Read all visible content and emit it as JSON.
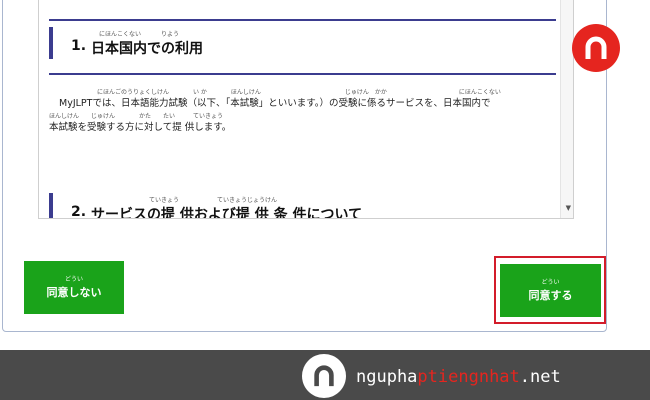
{
  "sections": [
    {
      "number": "1.",
      "title": "日本国内での利用",
      "ruby1": "にほんこくない",
      "ruby2": "りよう"
    },
    {
      "number": "2.",
      "title": "サービスの提 供および提 供 条 件について",
      "ruby1": "ていきょう",
      "ruby2": "ていきょうじょうけん"
    }
  ],
  "paragraph": {
    "line1": "MyJLPTでは、日本語能力試験（以下、「本試験」といいます。）の受験に係るサービスを、日本国内で",
    "line2": "本試験を受験する方に対して提 供します。",
    "ruby_line1": "にほんごのうりょくしけん　　　　い か　　　　ほんしけん　　　　　　　　　　　　　　じゅけん　かか　　　　　　　　　　　　にほんこくない",
    "ruby_line2": "ほんしけん　　じゅけん　　　　かた　　たい　　　ていきょう"
  },
  "buttons": {
    "disagree_ruby": "どうい",
    "disagree_label": "同意しない",
    "agree_ruby": "どうい",
    "agree_label": "同意する"
  },
  "colors": {
    "button_green": "#1aa31a",
    "highlight_red": "#d31c2a",
    "heading_bar": "#3b3c8f",
    "brand_red": "#e5251f",
    "footer_bg": "#4a4a4a"
  },
  "watermark": {
    "part1": "ngupha",
    "part2": "ptiengnhat",
    "part3": ".net"
  },
  "icons": {
    "top_logo": "brand-logo-icon",
    "footer_logo": "brand-logo-icon",
    "scroll_down": "scroll-down-arrow-icon"
  }
}
